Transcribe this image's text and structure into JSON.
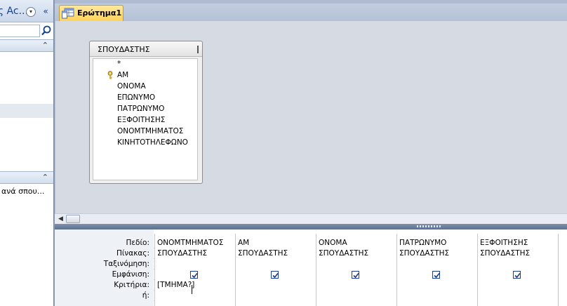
{
  "nav_pane": {
    "title": "ης Ac...",
    "dropdown_glyph": "▾",
    "collapse_glyph": "«",
    "search_placeholder": "",
    "group1_chevron": "⌃",
    "group2_chevron": "⌃",
    "query_item_label": "ανά σπου..."
  },
  "document": {
    "tab_label": "Ερώτημα1"
  },
  "table_box": {
    "title": "ΣΠΟΥΔΑΣΤΗΣ",
    "fields": [
      "*",
      "ΑΜ",
      "ΟΝΟΜΑ",
      "ΕΠΩΝΥΜΟ",
      "ΠΑΤΡΩΝΥΜΟ",
      "ΕΞΦΟΙΤΗΣΗΣ",
      "ΟΝΟΜΤΜΗΜΑΤΟΣ",
      "ΚΙΝΗΤΟΤΗΛΕΦΩΝΟ"
    ],
    "key_field_index": 1
  },
  "scrollbar": {
    "left_arrow": "◀"
  },
  "grid": {
    "row_labels": {
      "field": "Πεδίο:",
      "table": "Πίνακας:",
      "sort": "Ταξινόμηση:",
      "show": "Εμφάνιση:",
      "criteria": "Κριτήρια:",
      "or": "ή:"
    },
    "columns": [
      {
        "field": "ΟΝΟΜΤΜΗΜΑΤΟΣ",
        "table": "ΣΠΟΥΔΑΣΤΗΣ",
        "sort": "",
        "show": true,
        "criteria": "[ΤΜΗΜΑ?]",
        "or": ""
      },
      {
        "field": "ΑΜ",
        "table": "ΣΠΟΥΔΑΣΤΗΣ",
        "sort": "",
        "show": true,
        "criteria": "",
        "or": ""
      },
      {
        "field": "ΟΝΟΜΑ",
        "table": "ΣΠΟΥΔΑΣΤΗΣ",
        "sort": "",
        "show": true,
        "criteria": "",
        "or": ""
      },
      {
        "field": "ΠΑΤΡΩΝΥΜΟ",
        "table": "ΣΠΟΥΔΑΣΤΗΣ",
        "sort": "",
        "show": true,
        "criteria": "",
        "or": ""
      },
      {
        "field": "ΕΞΦΟΙΤΗΣΗΣ",
        "table": "ΣΠΟΥΔΑΣΤΗΣ",
        "sort": "",
        "show": true,
        "criteria": "",
        "or": ""
      }
    ]
  },
  "colors": {
    "tab_active": "#ffd35c",
    "nav_title": "#15428b",
    "checkbox_border": "#1c3f94"
  }
}
